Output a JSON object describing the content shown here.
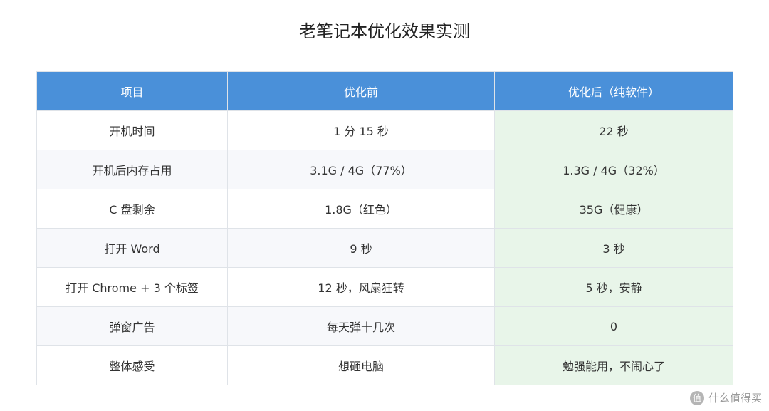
{
  "title": "老笔记本优化效果实测",
  "table": {
    "headers": [
      "项目",
      "优化前",
      "优化后（纯软件）"
    ],
    "rows": [
      {
        "item": "开机时间",
        "before": "1 分 15 秒",
        "after": "22 秒"
      },
      {
        "item": "开机后内存占用",
        "before": "3.1G / 4G（77%）",
        "after": "1.3G / 4G（32%）"
      },
      {
        "item": "C 盘剩余",
        "before": "1.8G（红色）",
        "after": "35G（健康）"
      },
      {
        "item": "打开 Word",
        "before": "9 秒",
        "after": "3 秒"
      },
      {
        "item": "打开 Chrome + 3 个标签",
        "before": "12 秒，风扇狂转",
        "after": "5 秒，安静"
      },
      {
        "item": "弹窗广告",
        "before": "每天弹十几次",
        "after": "0"
      },
      {
        "item": "整体感受",
        "before": "想砸电脑",
        "after": "勉强能用，不闹心了"
      }
    ]
  },
  "colors": {
    "header_bg": "#4a90d9",
    "after_bg": "#e8f5e9",
    "stripe_bg": "#f7f8fb"
  },
  "watermark": {
    "logo_text": "值",
    "text": "什么值得买"
  }
}
